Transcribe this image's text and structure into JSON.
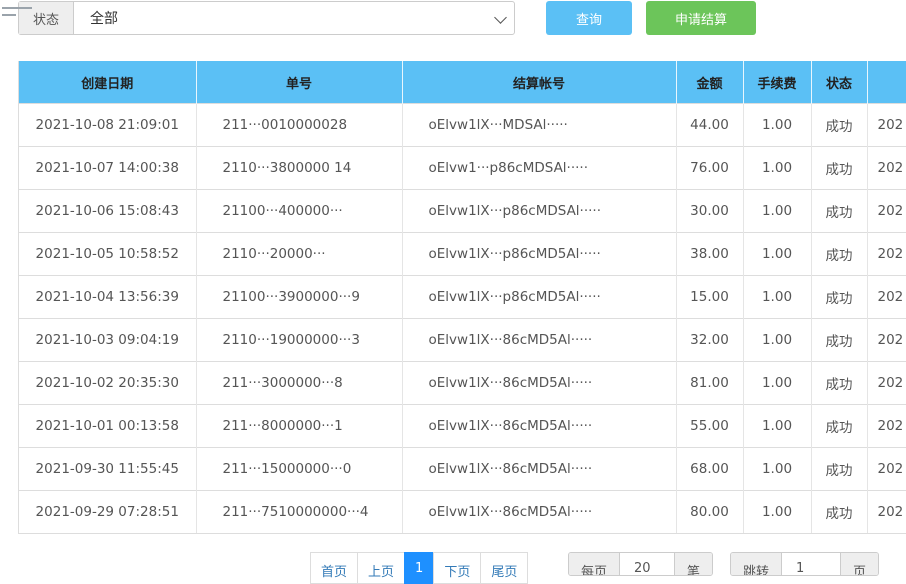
{
  "filter": {
    "label": "状态",
    "value": "全部"
  },
  "buttons": {
    "query": "查询",
    "settle": "申请结算"
  },
  "table": {
    "headers": [
      "创建日期",
      "单号",
      "结算帐号",
      "金额",
      "手续费",
      "状态",
      ""
    ],
    "rows": [
      {
        "date": "2021-10-08 21:09:01",
        "order": "211···0010000028",
        "account": "oElvw1lX···MDSAl·····",
        "amount": "44.00",
        "fee": "1.00",
        "status": "成功",
        "extra": "202"
      },
      {
        "date": "2021-10-07 14:00:38",
        "order": "2110···3800000 14",
        "account": "oElvw1···p86cMDSAl·····",
        "amount": "76.00",
        "fee": "1.00",
        "status": "成功",
        "extra": "202"
      },
      {
        "date": "2021-10-06 15:08:43",
        "order": "21100···400000···",
        "account": "oElvw1lX···p86cMDSAl·····",
        "amount": "30.00",
        "fee": "1.00",
        "status": "成功",
        "extra": "202"
      },
      {
        "date": "2021-10-05 10:58:52",
        "order": "2110···20000···",
        "account": "oElvw1lX···p86cMD5Al·····",
        "amount": "38.00",
        "fee": "1.00",
        "status": "成功",
        "extra": "202"
      },
      {
        "date": "2021-10-04 13:56:39",
        "order": "21100···3900000···9",
        "account": "oElvw1lX···p86cMD5Al·····",
        "amount": "15.00",
        "fee": "1.00",
        "status": "成功",
        "extra": "202"
      },
      {
        "date": "2021-10-03 09:04:19",
        "order": "2110···19000000···3",
        "account": "oElvw1lX···86cMD5Al·····",
        "amount": "32.00",
        "fee": "1.00",
        "status": "成功",
        "extra": "202"
      },
      {
        "date": "2021-10-02 20:35:30",
        "order": "211···3000000···8",
        "account": "oElvw1lX···86cMD5Al·····",
        "amount": "81.00",
        "fee": "1.00",
        "status": "成功",
        "extra": "202"
      },
      {
        "date": "2021-10-01 00:13:58",
        "order": "211···8000000···1",
        "account": "oElvw1lX···86cMD5Al·····",
        "amount": "55.00",
        "fee": "1.00",
        "status": "成功",
        "extra": "202"
      },
      {
        "date": "2021-09-30 11:55:45",
        "order": "211···15000000···0",
        "account": "oElvw1lX···86cMD5Al·····",
        "amount": "68.00",
        "fee": "1.00",
        "status": "成功",
        "extra": "202"
      },
      {
        "date": "2021-09-29 07:28:51",
        "order": "211···7510000000···4",
        "account": "oElvw1lX···86cMD5Al·····",
        "amount": "80.00",
        "fee": "1.00",
        "status": "成功",
        "extra": "202"
      }
    ]
  },
  "pagination": {
    "first": "首页",
    "prev": "上页",
    "current": "1",
    "next": "下页",
    "last": "尾页",
    "per_page_label": "每页",
    "per_page_value": "20",
    "per_page_suffix": "笔",
    "jump_label": "跳转",
    "jump_value": "1",
    "jump_suffix": "页"
  }
}
